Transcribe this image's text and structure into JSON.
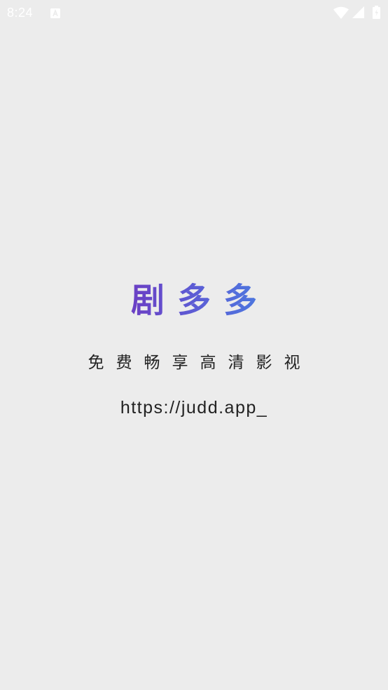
{
  "status_bar": {
    "time": "8:24",
    "icons": [
      "notification-a-icon",
      "wifi-icon",
      "signal-icon",
      "battery-icon"
    ]
  },
  "splash": {
    "title": "剧多多",
    "tagline": "免费畅享高清影视",
    "url": "https://judd.app_"
  },
  "colors": {
    "background": "#ececec",
    "title_gradient_start": "#6b3fc4",
    "title_gradient_end": "#4a7be0",
    "text": "#222222",
    "status_icons": "#ffffff"
  }
}
